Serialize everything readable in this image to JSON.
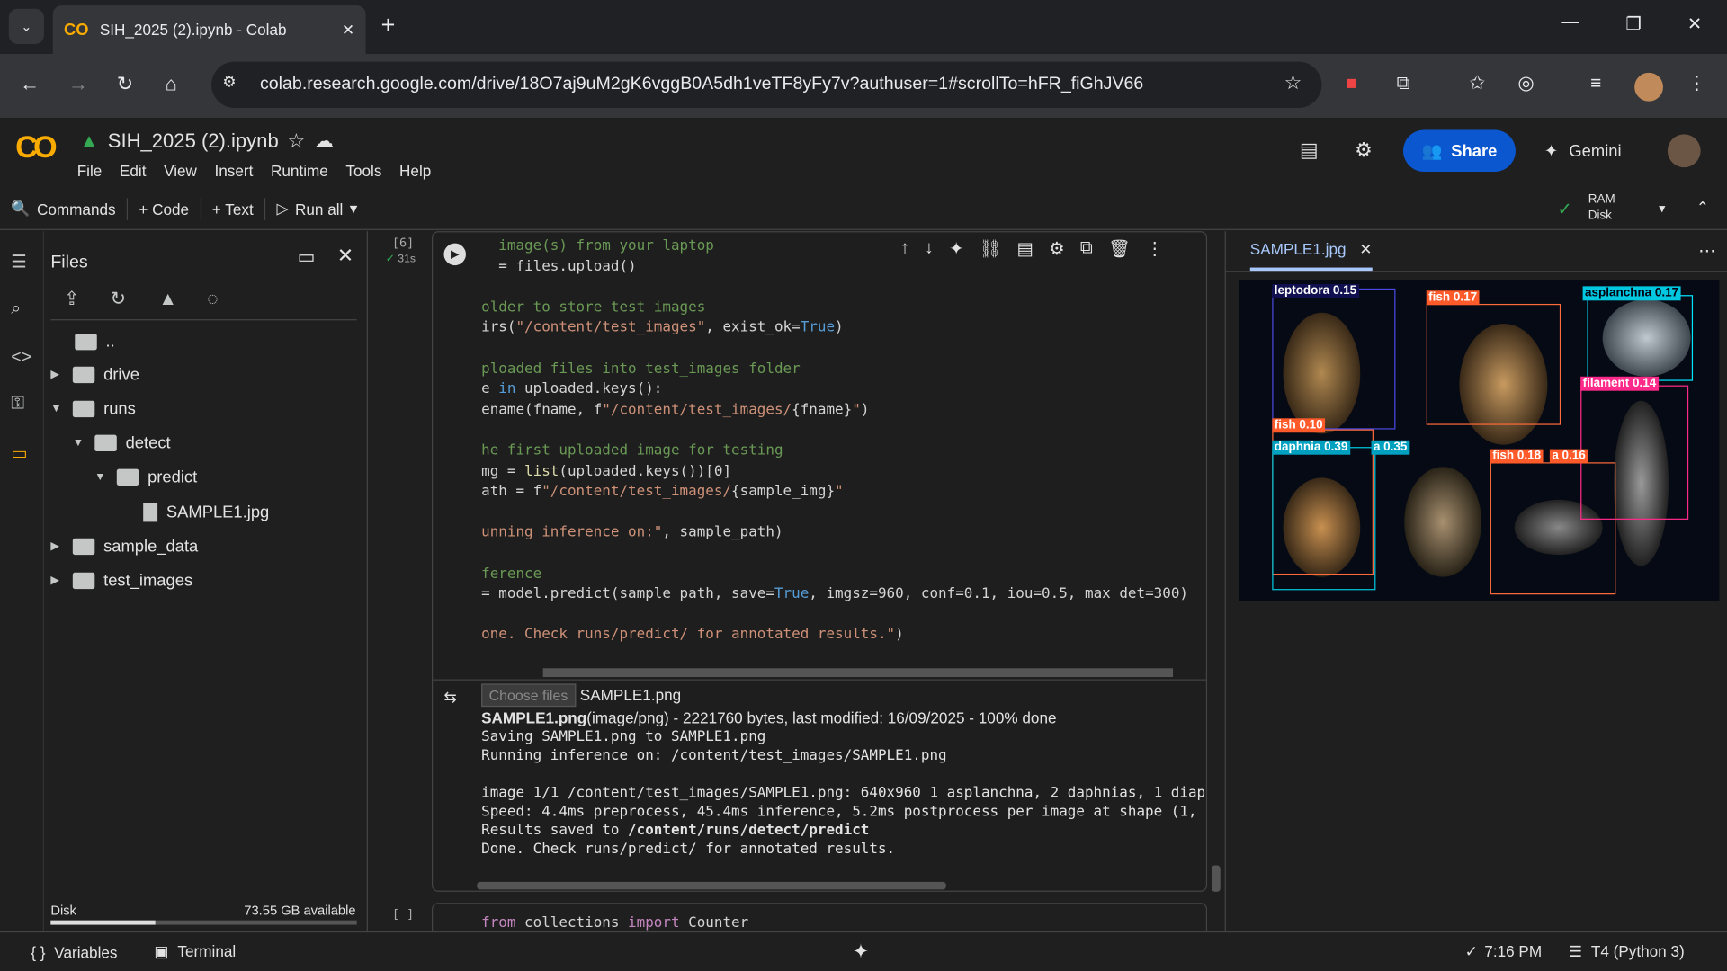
{
  "browser": {
    "tab_title": "SIH_2025 (2).ipynb - Colab",
    "url": "colab.research.google.com/drive/18O7aj9uM2gK6vggB0A5dh1veTF8yFy7v?authuser=1#scrollTo=hFR_fiGhJV66"
  },
  "notebook": {
    "title": "SIH_2025 (2).ipynb",
    "menus": [
      "File",
      "Edit",
      "View",
      "Insert",
      "Runtime",
      "Tools",
      "Help"
    ],
    "share_label": "Share",
    "gemini_label": "Gemini"
  },
  "toolbar": {
    "commands": "Commands",
    "code": "+ Code",
    "text": "+ Text",
    "run_all": "Run all",
    "ram": "RAM",
    "disk": "Disk"
  },
  "files": {
    "title": "Files",
    "tree": [
      {
        "name": ".."
      },
      {
        "name": "drive"
      },
      {
        "name": "runs"
      },
      {
        "name": "detect"
      },
      {
        "name": "predict"
      },
      {
        "name": "SAMPLE1.jpg"
      },
      {
        "name": "sample_data"
      },
      {
        "name": "test_images"
      }
    ],
    "disk_label": "Disk",
    "disk_available": "73.55 GB available",
    "disk_used_fraction": 0.34
  },
  "cell": {
    "exec_count": "[6]",
    "exec_time": "31s",
    "next_count": "[ ]",
    "output": {
      "choose_files": "Choose files",
      "chosen": "SAMPLE1.png",
      "file_bold": "SAMPLE1.png",
      "file_info": "(image/png) - 2221760 bytes, last modified: 16/09/2025 - 100% done",
      "line1": "Saving SAMPLE1.png to SAMPLE1.png",
      "line2": "Running inference on: /content/test_images/SAMPLE1.png",
      "line3": "image 1/1 /content/test_images/SAMPLE1.png: 640x960 1 asplanchna, 2 daphnias, 1 diaphan",
      "line4": "Speed: 4.4ms preprocess, 45.4ms inference, 5.2ms postprocess per image at shape (1, 3, ",
      "line5a": "Results saved to ",
      "line5b": "/content/runs/detect/predict",
      "line6": "Done. Check runs/predict/ for annotated results."
    },
    "next_code": "from collections import Counter"
  },
  "viewer": {
    "tab": "SAMPLE1.jpg",
    "labels": [
      "leptodora 0.15",
      "fish 0.17",
      "asplanchna 0.17",
      "filament 0.14",
      "fish 0.10",
      "daphnia 0.39",
      "a 0.35",
      "fish 0.18",
      "a 0.16"
    ]
  },
  "status": {
    "variables": "Variables",
    "terminal": "Terminal",
    "time": "7:16 PM",
    "runtime": "T4 (Python 3)"
  }
}
